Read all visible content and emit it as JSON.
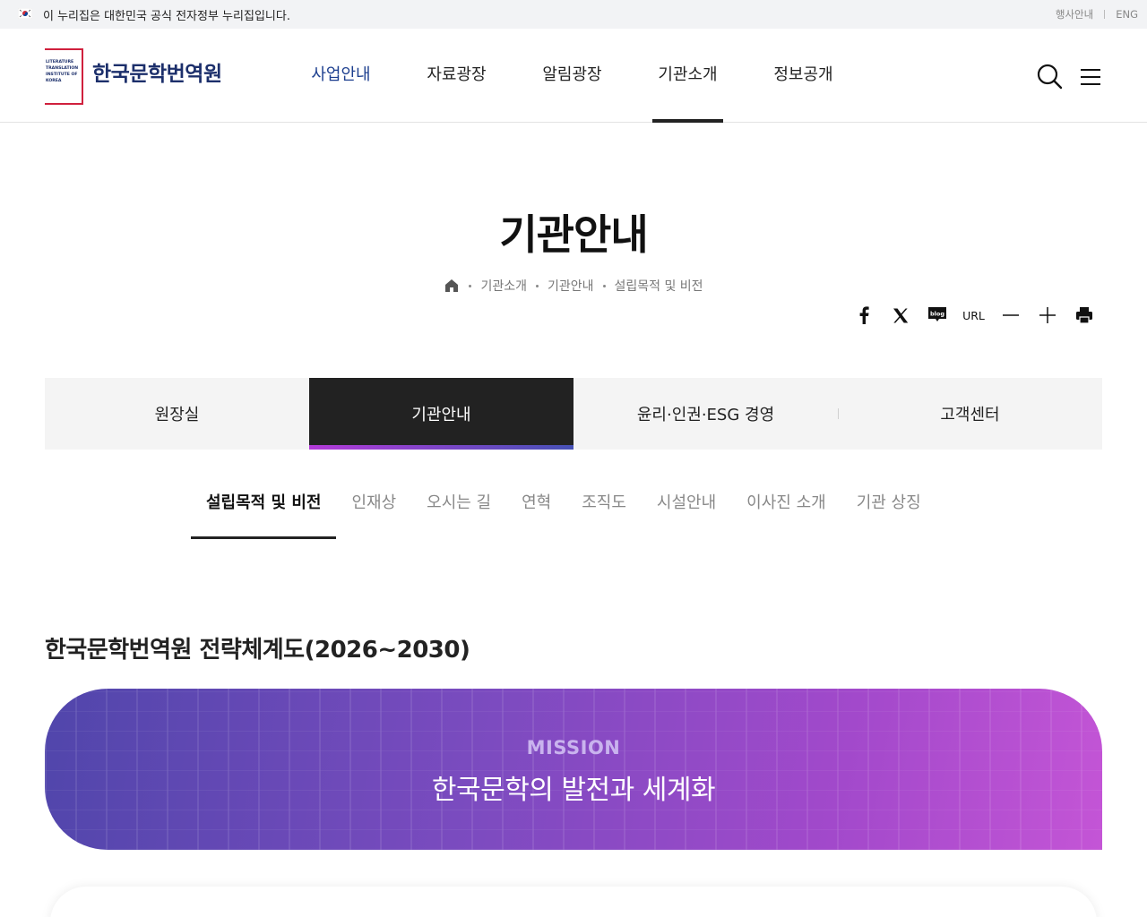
{
  "gov_banner": {
    "text": "이 누리집은 대한민국 공식 전자정부 누리집입니다."
  },
  "util_links": [
    "행사안내",
    "ENG"
  ],
  "logo": {
    "name": "한국문학번역원",
    "mark_text": [
      "LITERATURE",
      "TRANSLATION",
      "INSTITUTE OF",
      "KOREA"
    ]
  },
  "gnb": [
    "사업안내",
    "자료광장",
    "알림광장",
    "기관소개",
    "정보공개"
  ],
  "page": {
    "title": "기관안내",
    "breadcrumb": [
      "기관소개",
      "기관안내",
      "설립목적 및 비전"
    ]
  },
  "tools": {
    "url_label": "URL",
    "icons": [
      "facebook-icon",
      "x-twitter-icon",
      "blog-icon",
      "url",
      "zoom-out-icon",
      "zoom-in-icon",
      "print-icon"
    ],
    "blog_label": "blog"
  },
  "tabs": [
    "원장실",
    "기관안내",
    "윤리·인권·ESG 경영",
    "고객센터"
  ],
  "subtabs": [
    "설립목적 및 비전",
    "인재상",
    "오시는 길",
    "연혁",
    "조직도",
    "시설안내",
    "이사진 소개",
    "기관 상징"
  ],
  "section": {
    "title": "한국문학번역원 전략체계도(2026~2030)",
    "mission_label": "MISSION",
    "mission_text": "한국문학의 발전과 세계화"
  },
  "colors": {
    "brand_navy": "#1c2f6b",
    "brand_red": "#d0203d",
    "gradient_start": "#5046ab",
    "gradient_end": "#c455d6"
  }
}
